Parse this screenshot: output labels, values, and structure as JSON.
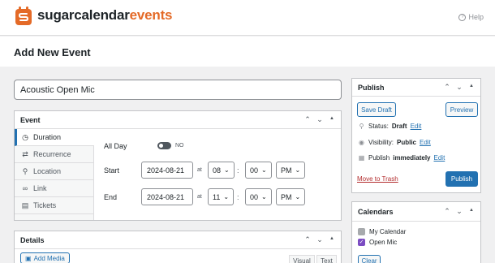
{
  "header": {
    "brand_part1": "sugarcalendar",
    "brand_part2": "events",
    "help_label": "Help",
    "accent_color": "#e46a27"
  },
  "page": {
    "title": "Add New Event"
  },
  "event_title": {
    "value": "Acoustic Open Mic"
  },
  "event_box": {
    "title": "Event",
    "tabs": [
      {
        "label": "Duration",
        "icon": "clock-icon"
      },
      {
        "label": "Recurrence",
        "icon": "recurrence-icon"
      },
      {
        "label": "Location",
        "icon": "location-icon"
      },
      {
        "label": "Link",
        "icon": "link-icon"
      },
      {
        "label": "Tickets",
        "icon": "tickets-icon"
      }
    ],
    "all_day": {
      "label": "All Day",
      "state": "NO"
    },
    "start": {
      "label": "Start",
      "date": "2024-08-21",
      "at": "at",
      "hour": "08",
      "sep": ":",
      "minute": "00",
      "ampm": "PM"
    },
    "end": {
      "label": "End",
      "date": "2024-08-21",
      "at": "at",
      "hour": "11",
      "sep": ":",
      "minute": "00",
      "ampm": "PM"
    }
  },
  "details_box": {
    "title": "Details",
    "add_media": "Add Media",
    "visual_tab": "Visual",
    "text_tab": "Text"
  },
  "publish_box": {
    "title": "Publish",
    "save_draft": "Save Draft",
    "preview": "Preview",
    "status_label": "Status:",
    "status_value": "Draft",
    "visibility_label": "Visibility:",
    "visibility_value": "Public",
    "publish_label": "Publish",
    "publish_value": "immediately",
    "edit": "Edit",
    "move_to_trash": "Move to Trash",
    "publish_button": "Publish"
  },
  "calendars_box": {
    "title": "Calendars",
    "items": [
      {
        "label": "My Calendar",
        "checked": false
      },
      {
        "label": "Open Mic",
        "checked": true
      }
    ],
    "clear": "Clear"
  }
}
